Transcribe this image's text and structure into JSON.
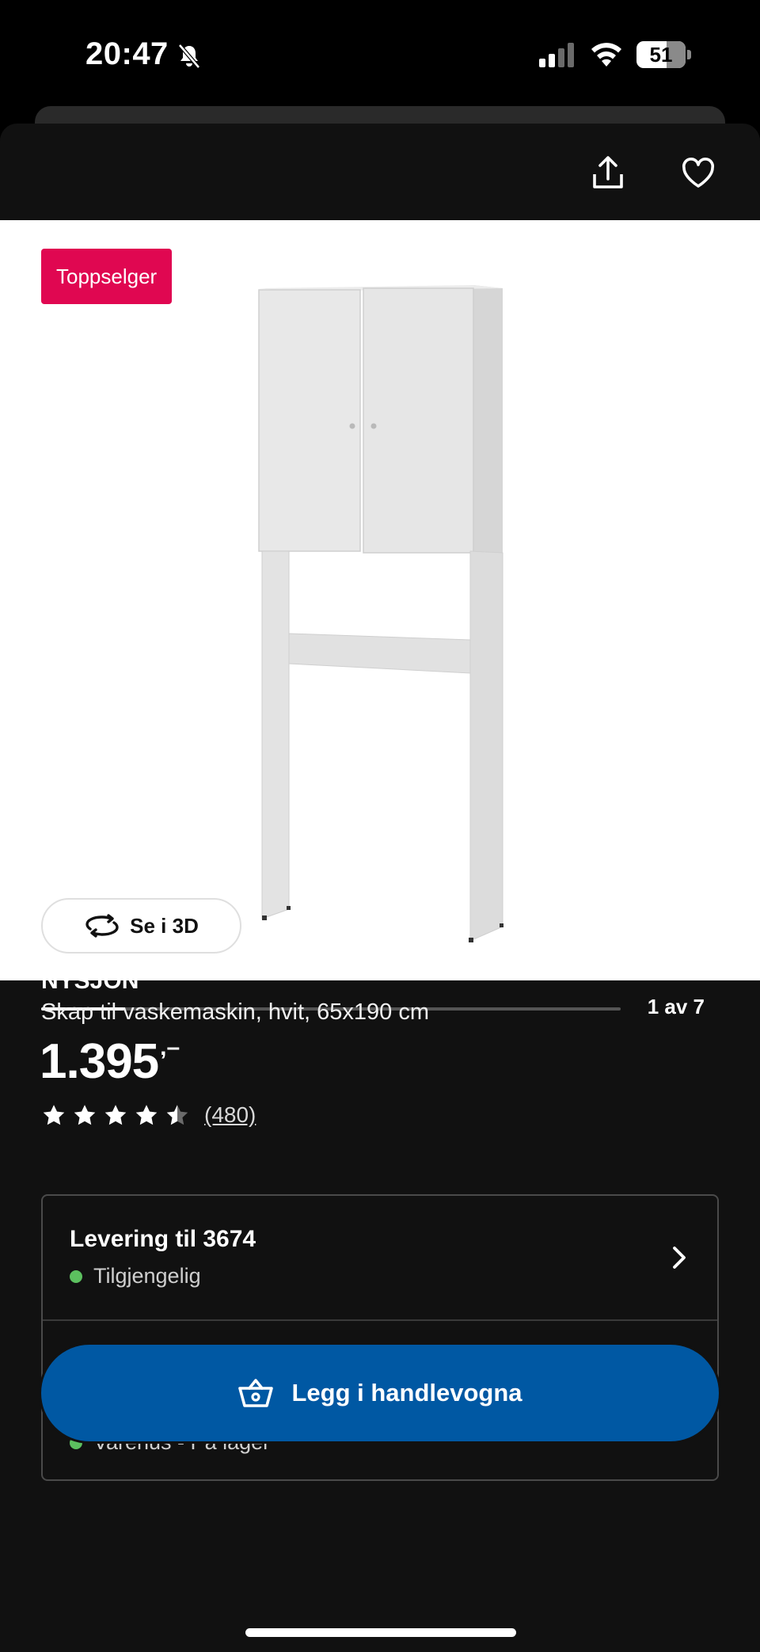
{
  "status_bar": {
    "time": "20:47",
    "battery": "51",
    "icons": [
      "bell-off-icon",
      "cellular-signal-icon",
      "wifi-icon",
      "battery-icon"
    ]
  },
  "header": {
    "icons": [
      "share-icon",
      "heart-icon"
    ]
  },
  "gallery": {
    "badge": "Toppselger",
    "view_3d_label": "Se i 3D",
    "pager_text": "1 av 7",
    "current_index": 1,
    "total": 7
  },
  "product": {
    "brand": "NYSJÖN",
    "description": "Skap til vaskemaskin, hvit, 65x190 cm",
    "price": "1.395",
    "price_suffix": ",–",
    "rating_value": 4.5,
    "rating_max": 5,
    "rating_count": "(480)"
  },
  "availability": {
    "delivery_title": "Levering til 3674",
    "delivery_status": "Tilgjengelig",
    "store_status": "Varehus - På lager",
    "status_color": "#5cc05f"
  },
  "cart": {
    "label": "Legg i handlevogna",
    "color": "#0058a3"
  },
  "badge_color": "#e00751"
}
